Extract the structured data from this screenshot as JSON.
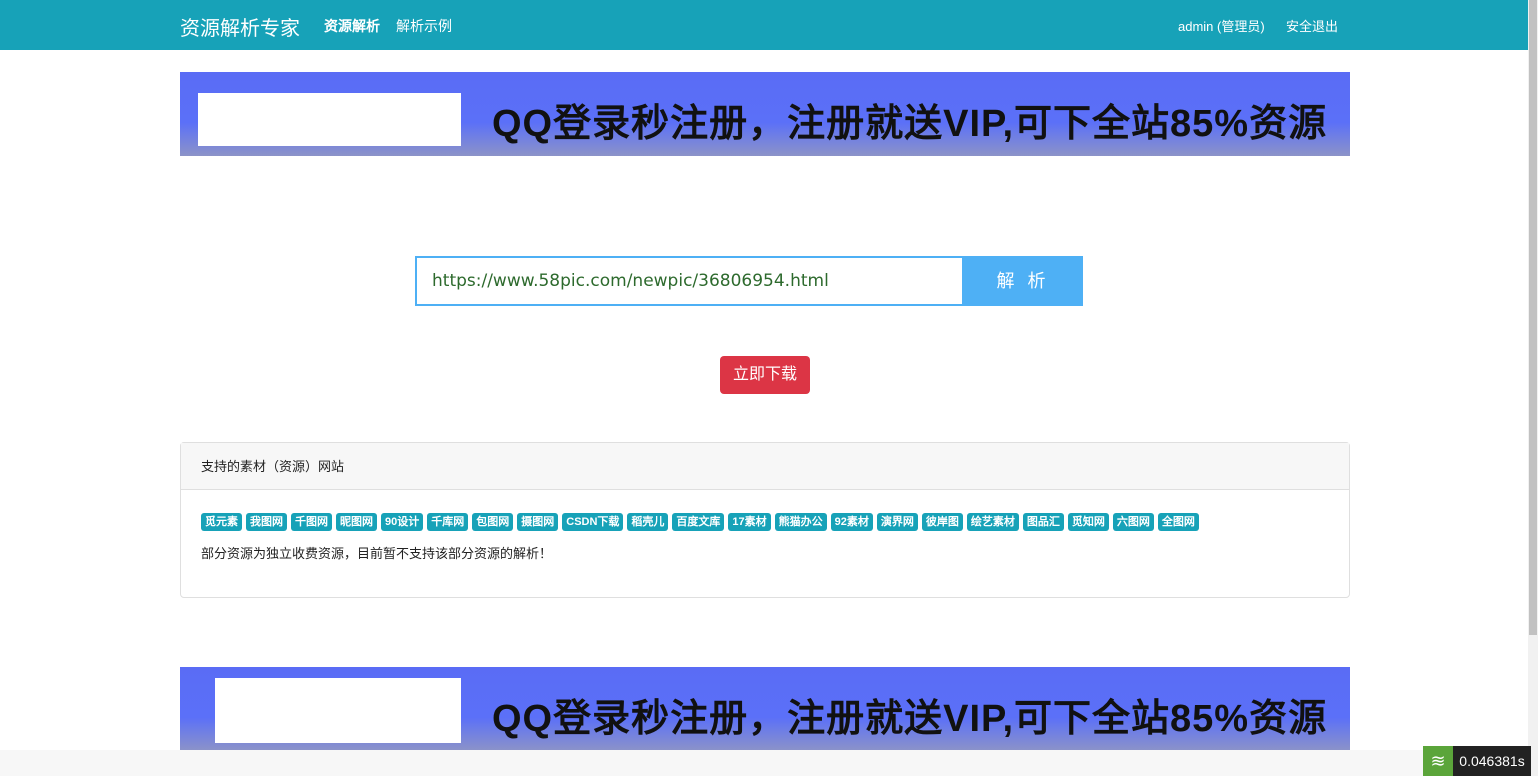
{
  "nav": {
    "brand": "资源解析专家",
    "links": [
      "资源解析",
      "解析示例"
    ],
    "user": "admin (管理员)",
    "logout": "安全退出"
  },
  "banner": {
    "text": "QQ登录秒注册，注册就送VIP,可下全站85%资源"
  },
  "search": {
    "value": "https://www.58pic.com/newpic/36806954.html",
    "button": "解 析"
  },
  "download": "立即下载",
  "card": {
    "title": "支持的素材（资源）网站",
    "tags": [
      "觅元素",
      "我图网",
      "千图网",
      "昵图网",
      "90设计",
      "千库网",
      "包图网",
      "摄图网",
      "CSDN下载",
      "稻壳儿",
      "百度文库",
      "17素材",
      "熊猫办公",
      "92素材",
      "演界网",
      "彼岸图",
      "绘艺素材",
      "图品汇",
      "觅知网",
      "六图网",
      "全图网"
    ],
    "note": "部分资源为独立收费资源，目前暂不支持该部分资源的解析！"
  },
  "timer": "0.046381s"
}
